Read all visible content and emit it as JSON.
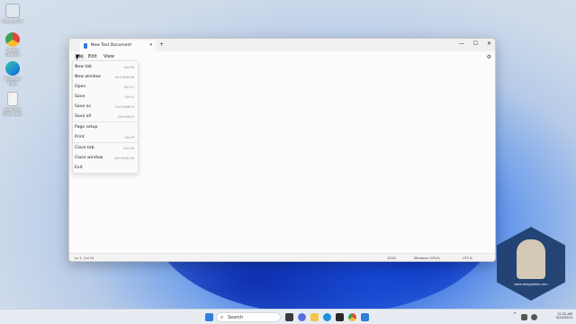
{
  "desktop": {
    "icons": [
      {
        "name": "Recycle Bin",
        "label": "Recycle Bin",
        "icon": "recycle-bin-icon",
        "color": "#dfe6ee"
      },
      {
        "name": "Google Chrome",
        "label": "Google Chrome",
        "icon": "chrome-icon",
        "color": "#e8453c"
      },
      {
        "name": "Microsoft Edge",
        "label": "Microsoft Edge",
        "icon": "edge-icon",
        "color": "#1f8fd8"
      },
      {
        "name": "New Text Document",
        "label": "New Text Document",
        "icon": "text-file-icon",
        "color": "#f4f4f4"
      }
    ]
  },
  "notepad": {
    "tab_title": "New Text Document",
    "tab_close_glyph": "▾",
    "new_tab_glyph": "+",
    "window_controls": {
      "minimize": "—",
      "maximize": "☐",
      "close": "✕"
    },
    "menu": {
      "file": "File",
      "edit": "Edit",
      "view": "View"
    },
    "settings_glyph": "⚙",
    "file_menu": [
      {
        "label": "New tab",
        "shortcut": "Ctrl+N"
      },
      {
        "label": "New window",
        "shortcut": "Ctrl+Shift+N"
      },
      {
        "label": "Open",
        "shortcut": "Ctrl+O"
      },
      {
        "label": "Save",
        "shortcut": "Ctrl+S"
      },
      {
        "label": "Save as",
        "shortcut": "Ctrl+Shift+S"
      },
      {
        "label": "Save all",
        "shortcut": "Ctrl+Alt+S"
      },
      {
        "label": "Page setup",
        "shortcut": ""
      },
      {
        "label": "Print",
        "shortcut": "Ctrl+P"
      },
      {
        "label": "Close tab",
        "shortcut": "Ctrl+W"
      },
      {
        "label": "Close window",
        "shortcut": "Ctrl+Shift+W"
      },
      {
        "label": "Exit",
        "shortcut": ""
      }
    ],
    "status": {
      "position": "Ln 1, Col 14",
      "zoom": "100%",
      "line_ending": "Windows (CRLF)",
      "encoding": "UTF-8"
    }
  },
  "watermark": {
    "text": "www.bongotoles.com",
    "color": "#1f3f6e"
  },
  "taskbar": {
    "search_label": "Search",
    "search_glyph": "⌕",
    "time": "12:22 AM",
    "date": "5/20/2023",
    "tray_glyph": "^"
  },
  "colors": {
    "accent": "#2d7fd8",
    "taskbar": "#e7ecf3"
  }
}
